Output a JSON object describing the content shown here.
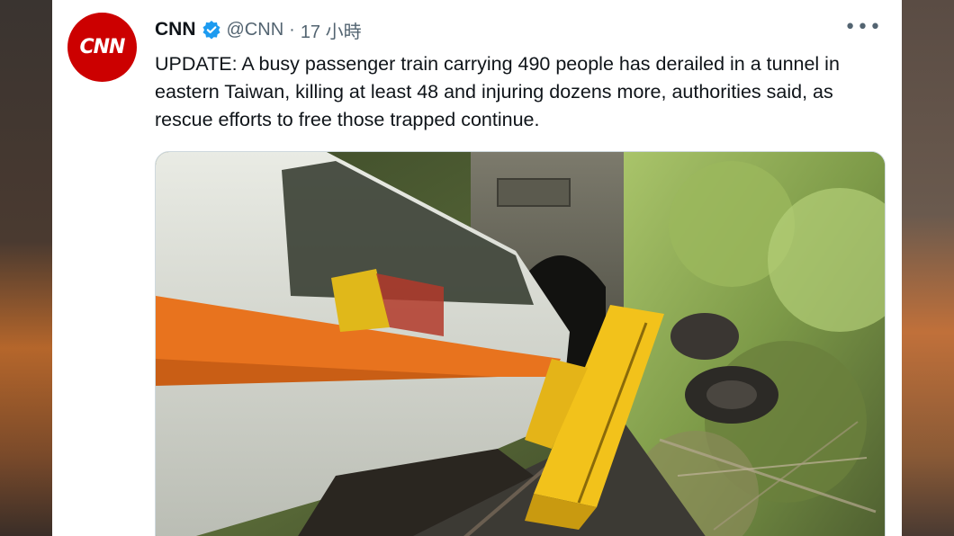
{
  "tweet": {
    "author_name": "CNN",
    "author_handle": "@CNN",
    "separator": "·",
    "timestamp": "17 小時",
    "more_label": "•••",
    "avatar_text": "CNN",
    "text": "UPDATE: A busy passenger train carrying 490 people has derailed in a tunnel in eastern Taiwan, killing at least 48 and injuring dozens more, authorities said, as rescue efforts to free those trapped continue."
  },
  "icons": {
    "verified": "verified-badge-icon",
    "more": "more-options-icon"
  },
  "colors": {
    "brand_red": "#cc0000",
    "verified_blue": "#1d9bf0",
    "text_primary": "#0f1419",
    "text_secondary": "#536471",
    "train_orange": "#e8731e",
    "crane_yellow": "#f2c21b"
  }
}
